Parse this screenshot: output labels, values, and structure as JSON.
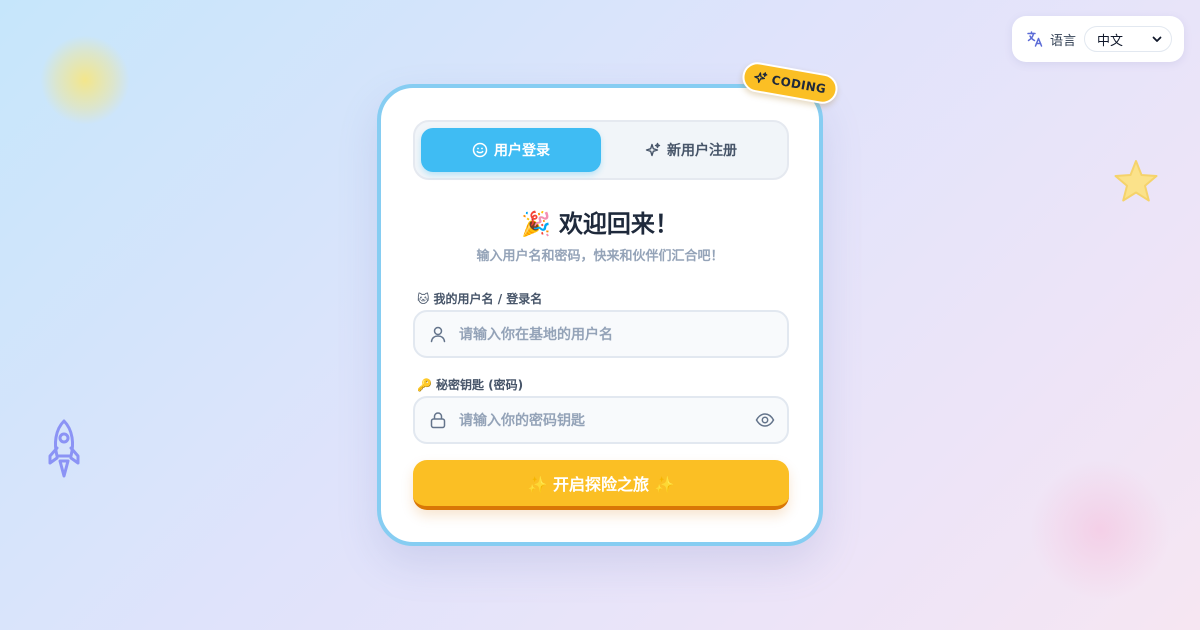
{
  "language": {
    "icon": "translate-icon",
    "label": "语言",
    "selected": "中文",
    "chevron_icon": "chevron-down-icon"
  },
  "badge": {
    "icon": "sparkles-icon",
    "text": "CODING"
  },
  "tabs": [
    {
      "label": "用户登录",
      "icon": "smile-icon",
      "active": true
    },
    {
      "label": "新用户注册",
      "icon": "sparkles-icon",
      "active": false
    }
  ],
  "welcome": {
    "emoji": "🎉",
    "title": "欢迎回来！",
    "subtitle": "输入用户名和密码，快来和伙伴们汇合吧！"
  },
  "username": {
    "label_emoji": "🐱",
    "label": "我的用户名 / 登录名",
    "placeholder": "请输入你在基地的用户名",
    "icon": "user-icon"
  },
  "password": {
    "label_emoji": "🔑",
    "label": "秘密钥匙 (密码)",
    "placeholder": "请输入你的密码钥匙",
    "icon": "lock-icon",
    "toggle_icon": "eye-icon"
  },
  "submit": {
    "label": "✨ 开启探险之旅 ✨"
  },
  "decorations": {
    "star": "star-icon",
    "rocket": "rocket-icon"
  },
  "colors": {
    "primary": "#3fbcf3",
    "accent": "#fbbf24",
    "card_border": "#86cdf2"
  }
}
